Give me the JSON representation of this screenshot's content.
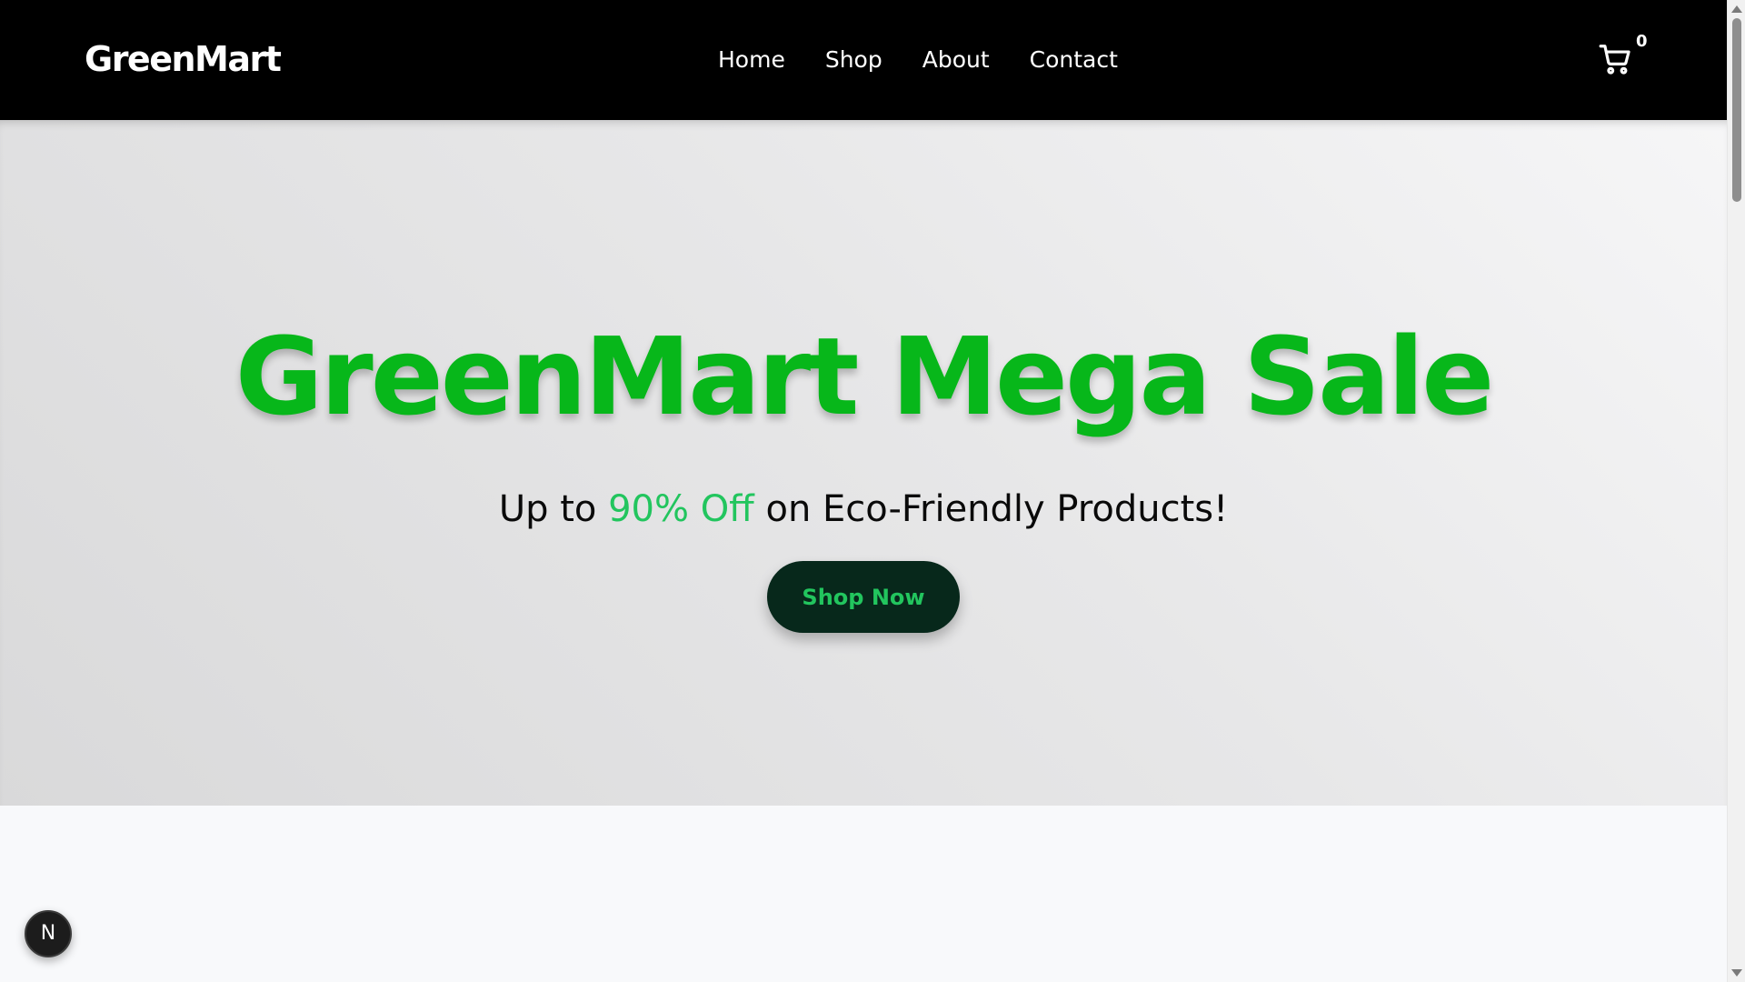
{
  "header": {
    "brand": "GreenMart",
    "nav": [
      {
        "label": "Home"
      },
      {
        "label": "Shop"
      },
      {
        "label": "About"
      },
      {
        "label": "Contact"
      }
    ],
    "cart_icon": "shopping-cart-icon",
    "cart_count": "0"
  },
  "hero": {
    "title": "GreenMart Mega Sale",
    "subtitle_before": "Up to ",
    "subtitle_highlight": "90% Off",
    "subtitle_after": " on Eco-Friendly Products!",
    "cta_label": "Shop Now"
  },
  "dev_badge": {
    "label": "N",
    "icon": "nextjs-devtools-icon"
  },
  "colors": {
    "nav_bg": "#000000",
    "title_green": "#07b71a",
    "accent_green": "#22c55e",
    "button_bg": "#07281b"
  }
}
